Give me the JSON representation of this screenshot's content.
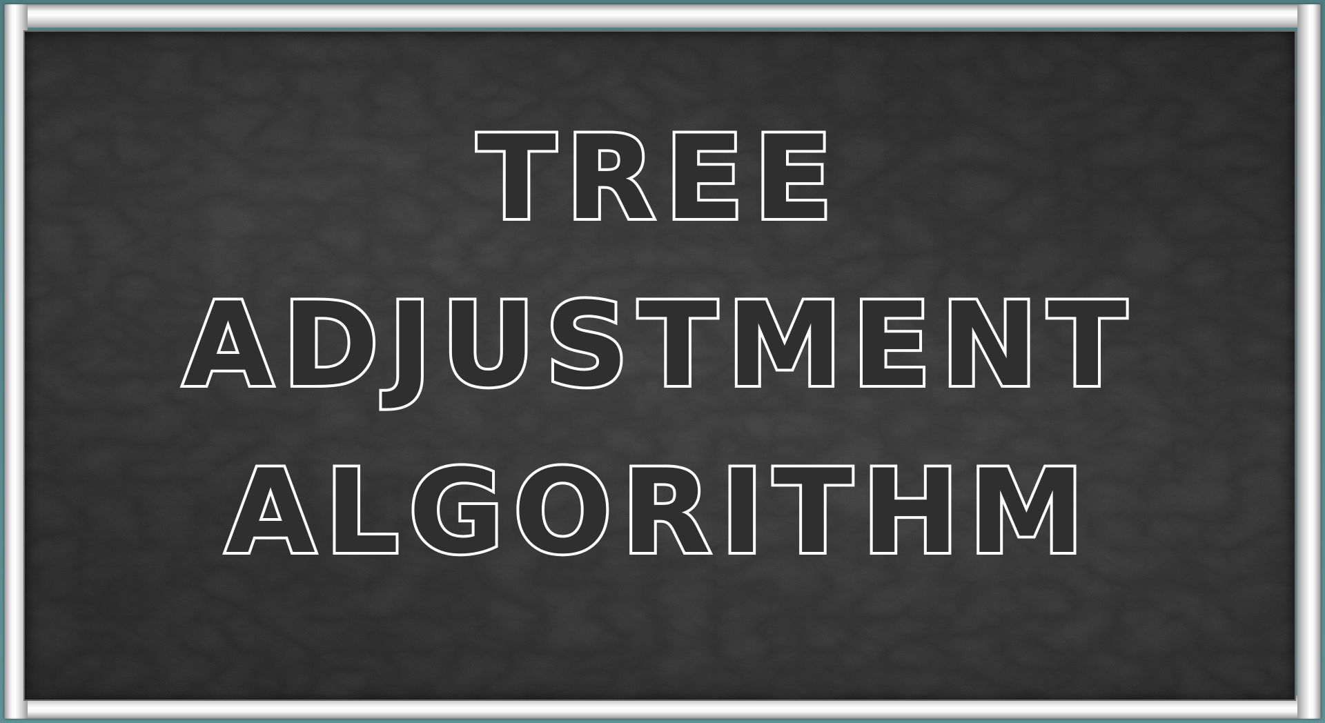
{
  "title": {
    "lines": [
      "TREE",
      "ADJUSTMENT",
      "ALGORITHM"
    ]
  },
  "colors": {
    "background": "#2f2f2f",
    "frame_accent": "#5f9196",
    "frame_metal": "#e6e6e6",
    "text_outline": "#ffffff"
  }
}
